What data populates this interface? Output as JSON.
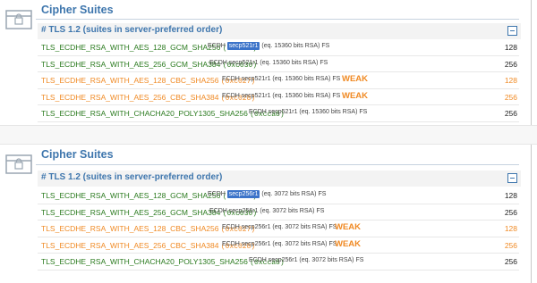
{
  "sections": [
    {
      "title": "Cipher Suites",
      "subheading": "# TLS 1.2 (suites in server-preferred order)",
      "collapse_symbol": "−",
      "rows": [
        {
          "name": "TLS_ECDHE_RSA_WITH_AES_128_GCM_SHA256",
          "code": "(0xc02f)",
          "kx_prefix": "ECDH ",
          "kx_curve": "secp521r1",
          "kx_rest": " (eq. 15360 bits RSA)   FS",
          "weak": "",
          "bits": "128",
          "warn": false,
          "highlight": true
        },
        {
          "name": "TLS_ECDHE_RSA_WITH_AES_256_GCM_SHA384",
          "code": "(0xc030)",
          "kx_prefix": "ECDH ",
          "kx_curve": "secp521r1",
          "kx_rest": " (eq. 15360 bits RSA)   FS",
          "weak": "",
          "bits": "256",
          "warn": false,
          "highlight": false
        },
        {
          "name": "TLS_ECDHE_RSA_WITH_AES_128_CBC_SHA256",
          "code": "(0xc027)",
          "kx_prefix": "ECDH ",
          "kx_curve": "secp521r1",
          "kx_rest": " (eq. 15360 bits RSA)   FS",
          "weak": "WEAK",
          "bits": "128",
          "warn": true,
          "highlight": false
        },
        {
          "name": "TLS_ECDHE_RSA_WITH_AES_256_CBC_SHA384",
          "code": "(0xc028)",
          "kx_prefix": "ECDH ",
          "kx_curve": "secp521r1",
          "kx_rest": " (eq. 15360 bits RSA)   FS",
          "weak": "WEAK",
          "bits": "256",
          "warn": true,
          "highlight": false
        },
        {
          "name": "TLS_ECDHE_RSA_WITH_CHACHA20_POLY1305_SHA256",
          "code": "(0xcca8)",
          "kx_prefix": "ECDH ",
          "kx_curve": "secp521r1",
          "kx_rest": " (eq. 15360 bits RSA)   FS",
          "weak": "",
          "bits": "256",
          "warn": false,
          "highlight": false
        }
      ]
    },
    {
      "title": "Cipher Suites",
      "subheading": "# TLS 1.2 (suites in server-preferred order)",
      "collapse_symbol": "−",
      "rows": [
        {
          "name": "TLS_ECDHE_RSA_WITH_AES_128_GCM_SHA256",
          "code": "(0xc02f)",
          "kx_prefix": "ECDH ",
          "kx_curve": "secp256r1",
          "kx_rest": " (eq. 3072 bits RSA)   FS",
          "weak": "",
          "bits": "128",
          "warn": false,
          "highlight": true
        },
        {
          "name": "TLS_ECDHE_RSA_WITH_AES_256_GCM_SHA384",
          "code": "(0xc030)",
          "kx_prefix": "ECDH ",
          "kx_curve": "secp256r1",
          "kx_rest": " (eq. 3072 bits RSA)   FS",
          "weak": "",
          "bits": "256",
          "warn": false,
          "highlight": false
        },
        {
          "name": "TLS_ECDHE_RSA_WITH_AES_128_CBC_SHA256",
          "code": "(0xc027)",
          "kx_prefix": "ECDH ",
          "kx_curve": "secp256r1",
          "kx_rest": " (eq. 3072 bits RSA)   FS",
          "weak": "WEAK",
          "bits": "128",
          "warn": true,
          "highlight": false
        },
        {
          "name": "TLS_ECDHE_RSA_WITH_AES_256_CBC_SHA384",
          "code": "(0xc028)",
          "kx_prefix": "ECDH ",
          "kx_curve": "secp256r1",
          "kx_rest": " (eq. 3072 bits RSA)   FS",
          "weak": "WEAK",
          "bits": "256",
          "warn": true,
          "highlight": false
        },
        {
          "name": "TLS_ECDHE_RSA_WITH_CHACHA20_POLY1305_SHA256",
          "code": "(0xcca8)",
          "kx_prefix": "ECDH ",
          "kx_curve": "secp256r1",
          "kx_rest": " (eq. 3072 bits RSA)   FS",
          "weak": "",
          "bits": "256",
          "warn": false,
          "highlight": false
        }
      ]
    }
  ],
  "icon": "lock-box-icon",
  "colors": {
    "title": "#3e76ad",
    "ok": "#2a7a1e",
    "warn": "#f08a24",
    "highlight": "#3b73c9"
  }
}
